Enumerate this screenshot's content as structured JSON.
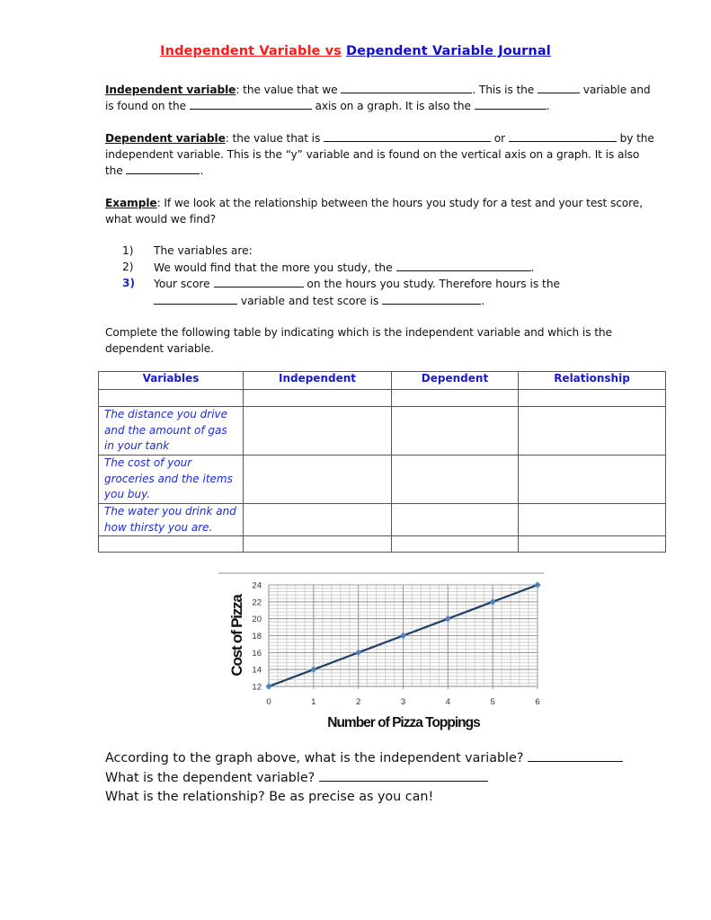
{
  "title": {
    "part1": "Independent Variable vs",
    "part2": "Dependent Variable Journal",
    "colors": {
      "part1": "#ff1a1a",
      "part2": "#1010d0"
    }
  },
  "independent": {
    "term": "Independent variable",
    "t1": ": the value that we ",
    "t2": ". This is the ",
    "t3": " variable and is found on the ",
    "t4": " axis on a graph.   It is also the ",
    "t5": "."
  },
  "dependent": {
    "term": "Dependent variable",
    "t1": ": the value that is ",
    "t2": " or ",
    "t3": " by the independent variable.  This is the “y” variable and is found on the vertical axis on a graph.  It is also the ",
    "t4": "."
  },
  "example": {
    "term": "Example",
    "text": ":  If we look at the relationship between the hours you study for a test and your test score, what would we find?",
    "items": [
      {
        "num": "1)",
        "text": "The variables are:"
      },
      {
        "num": "2)",
        "text": "We would find that the more you study, the ",
        "end": "."
      },
      {
        "num": "3)",
        "text": "Your score ",
        "mid": " on the hours you study.  Therefore hours is the",
        "line2_mid": " variable and test score is ",
        "end": "."
      }
    ]
  },
  "table_intro": "Complete the following table by indicating which is the independent variable and which is the dependent variable.",
  "table": {
    "headers": [
      "Variables",
      "Independent",
      "Dependent",
      "Relationship"
    ],
    "rows": [
      "",
      "The distance you drive and the amount of gas in your tank",
      "The cost of your groceries and the items you buy.",
      "The water you drink and how thirsty you are.",
      ""
    ]
  },
  "chart_data": {
    "type": "line",
    "title": "",
    "xlabel": "Number of Pizza Toppings",
    "ylabel": "Cost of Pizza",
    "x": [
      0,
      1,
      2,
      3,
      4,
      5,
      6
    ],
    "series": [
      {
        "name": "Cost of Pizza",
        "values": [
          12,
          14,
          16,
          18,
          20,
          22,
          24
        ],
        "color": "#1f3f66",
        "marker_color": "#4a7fc0"
      }
    ],
    "xlim": [
      0,
      6
    ],
    "ylim": [
      12,
      24
    ],
    "xticks": [
      "0",
      "1",
      "2",
      "3",
      "4",
      "5",
      "6"
    ],
    "yticks": [
      "12",
      "14",
      "16",
      "18",
      "20",
      "22",
      "24"
    ],
    "grid": true,
    "legend": "none"
  },
  "questions": {
    "q1": "According to the graph above, what is the independent variable?  ",
    "q2": "What is the dependent variable?  ",
    "q3": "What is the relationship?  Be as precise as you can!"
  }
}
